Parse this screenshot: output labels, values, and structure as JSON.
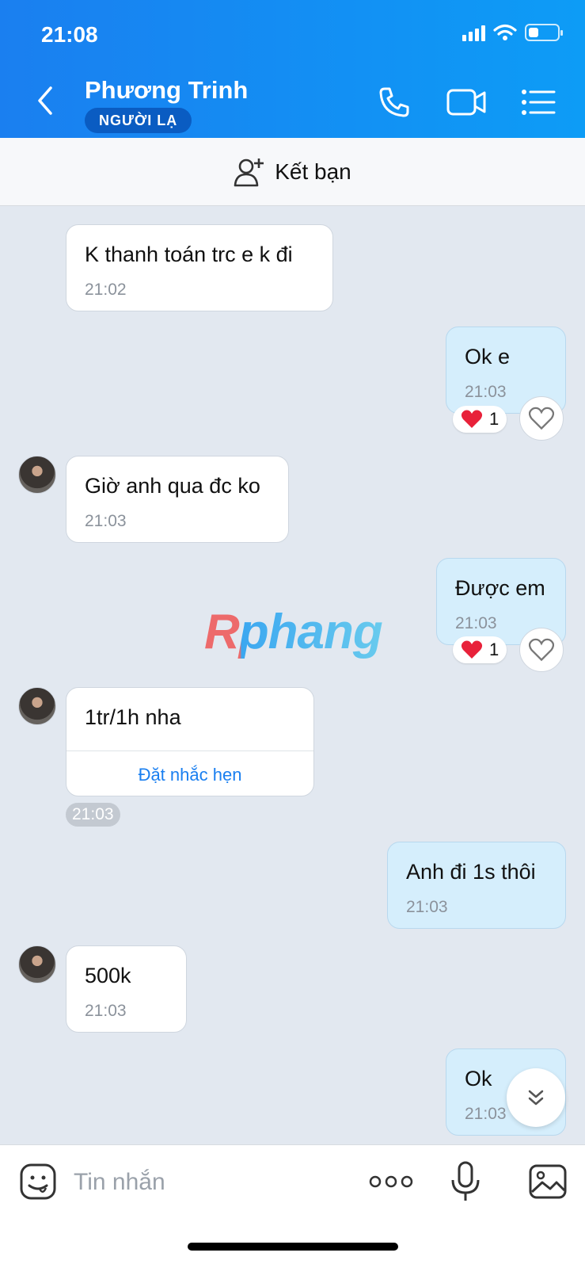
{
  "status_bar": {
    "time": "21:08",
    "battery_percent": 35
  },
  "header": {
    "contact_name": "Phương Trinh",
    "badge": "NGƯỜI LẠ"
  },
  "add_friend": {
    "label": "Kết bạn"
  },
  "messages": [
    {
      "direction": "in",
      "text": "K thanh toán trc e k đi",
      "time": "21:02"
    },
    {
      "direction": "out",
      "text": "Ok e",
      "time": "21:03",
      "reaction": {
        "emoji": "❤️",
        "count": "1"
      }
    },
    {
      "direction": "in",
      "text": "Giờ anh qua đc ko",
      "time": "21:03"
    },
    {
      "direction": "out",
      "text": "Được em",
      "time": "21:03",
      "reaction": {
        "emoji": "❤️",
        "count": "1"
      }
    },
    {
      "direction": "in",
      "text": "1tr/1h nha",
      "time": "21:03",
      "action": "Đặt nhắc hẹn"
    },
    {
      "direction": "out",
      "text": "Anh đi 1s thôi",
      "time": "21:03"
    },
    {
      "direction": "in",
      "text": "500k",
      "time": "21:03"
    },
    {
      "direction": "out",
      "text": "Ok",
      "time": "21:03"
    }
  ],
  "watermark": "Rphang",
  "composer": {
    "placeholder": "Tin nhắn"
  },
  "colors": {
    "header": "#1a7ff0",
    "outgoing_bubble": "#d5eefc",
    "link": "#1a7ff0",
    "heart": "#e8213a"
  },
  "icons": [
    "back-icon",
    "phone-icon",
    "video-icon",
    "menu-list-icon",
    "add-friend-icon",
    "heart-outline-icon",
    "chevron-double-down-icon",
    "emoji-icon",
    "more-icon",
    "microphone-icon",
    "image-icon"
  ]
}
